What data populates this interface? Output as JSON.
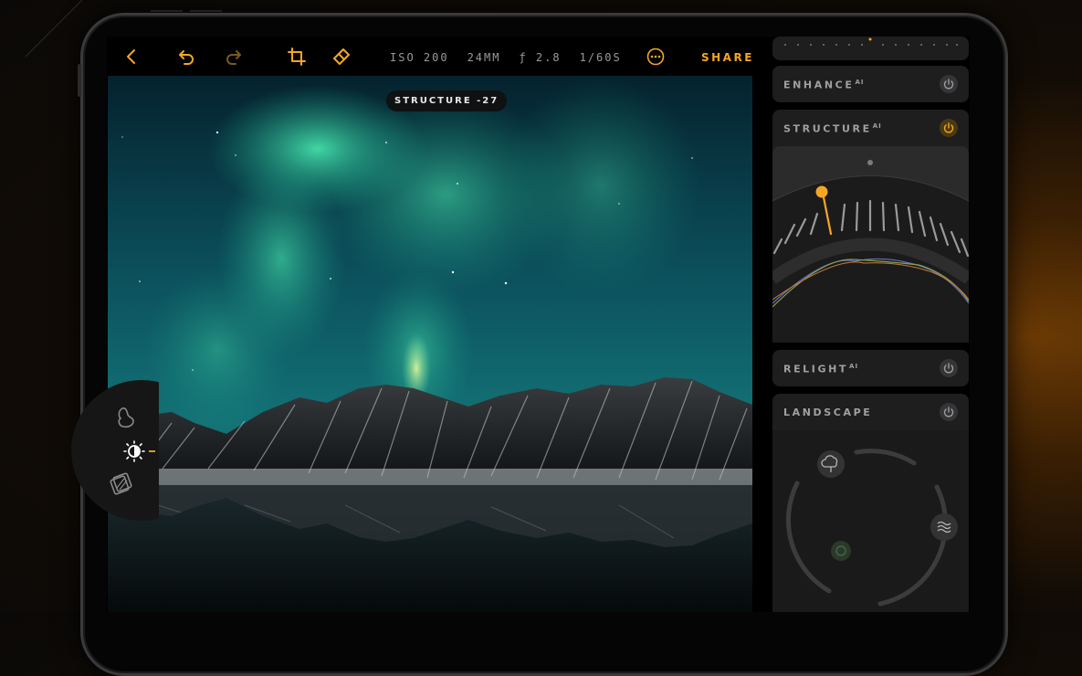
{
  "toolbar": {
    "exif": {
      "iso": "ISO 200",
      "focal": "24MM",
      "aperture": "ƒ 2.8",
      "shutter": "1/60S"
    },
    "share_label": "SHARE",
    "icons": [
      "back-chevron-icon",
      "undo-icon",
      "redo-icon",
      "crop-icon",
      "eraser-icon",
      "more-icon"
    ]
  },
  "badge": {
    "label": "STRUCTURE -27"
  },
  "tools": [
    "mask-icon",
    "light-adjust-icon",
    "layers-icon"
  ],
  "panel": {
    "enhance": {
      "label": "ENHANCE",
      "sup": "AI",
      "enabled": false
    },
    "structure": {
      "label": "STRUCTURE",
      "sup": "AI",
      "enabled": true,
      "value": -27
    },
    "relight": {
      "label": "RELIGHT",
      "sup": "AI",
      "enabled": false
    },
    "landscape": {
      "label": "LANDSCAPE",
      "enabled": false,
      "icons": [
        "tree-icon",
        "water-icon",
        "foliage-icon"
      ]
    }
  },
  "colors": {
    "accent": "#f5a623",
    "card": "#1e1e1f",
    "aurora": "#3fd6a6"
  }
}
